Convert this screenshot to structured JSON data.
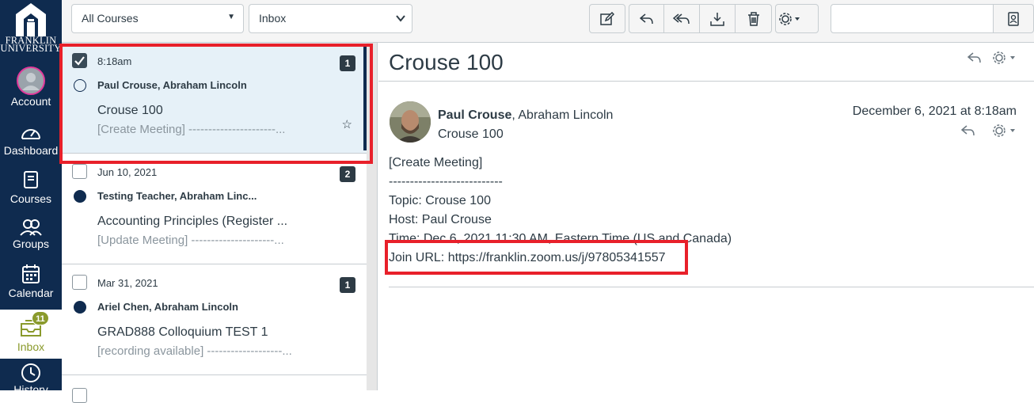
{
  "nav": {
    "logo_line1": "FRANKLIN",
    "logo_line2": "UNIVERSITY",
    "items": [
      {
        "label": "Account"
      },
      {
        "label": "Dashboard"
      },
      {
        "label": "Courses"
      },
      {
        "label": "Groups"
      },
      {
        "label": "Calendar"
      },
      {
        "label": "Inbox",
        "badge": "11"
      },
      {
        "label": "History"
      }
    ]
  },
  "toolbar": {
    "course_filter": "All Courses",
    "mailbox_filter": "Inbox",
    "icons": [
      "compose-icon",
      "reply-icon",
      "reply-all-icon",
      "archive-icon",
      "delete-icon",
      "settings-icon"
    ],
    "search_placeholder": "",
    "address_book_icon": "address-book-icon"
  },
  "messages": [
    {
      "date": "8:18am",
      "count": "1",
      "from": "Paul Crouse, Abraham Lincoln",
      "subject": "Crouse 100",
      "preview": "[Create Meeting] ----------------------...",
      "read": true,
      "checked": true,
      "selected": true
    },
    {
      "date": "Jun 10, 2021",
      "count": "2",
      "from": "Testing Teacher, Abraham Linc...",
      "subject": "Accounting Principles (Register ...",
      "preview": "[Update Meeting] ---------------------...",
      "read": false,
      "checked": false,
      "selected": false
    },
    {
      "date": "Mar 31, 2021",
      "count": "1",
      "from": "Ariel Chen, Abraham Lincoln",
      "subject": "GRAD888 Colloquium TEST 1",
      "preview": "[recording available] -------------------...",
      "read": false,
      "checked": false,
      "selected": false
    }
  ],
  "detail": {
    "title": "Crouse 100",
    "author_bold": "Paul Crouse",
    "author_rest": ", Abraham Lincoln",
    "subject": "Crouse 100",
    "date": "December 6, 2021 at 8:18am",
    "body": [
      "[Create Meeting]",
      "---------------------------",
      "Topic: Crouse 100",
      "Host: Paul Crouse",
      "Time: Dec 6, 2021 11:30 AM, Eastern Time (US and Canada)",
      "Join URL: https://franklin.zoom.us/j/97805341557"
    ]
  },
  "colors": {
    "nav_bg": "#0f2b4f",
    "accent_green": "#8a9a2c",
    "highlight_red": "#e8202a",
    "selected_bg": "#e6f1f8"
  }
}
